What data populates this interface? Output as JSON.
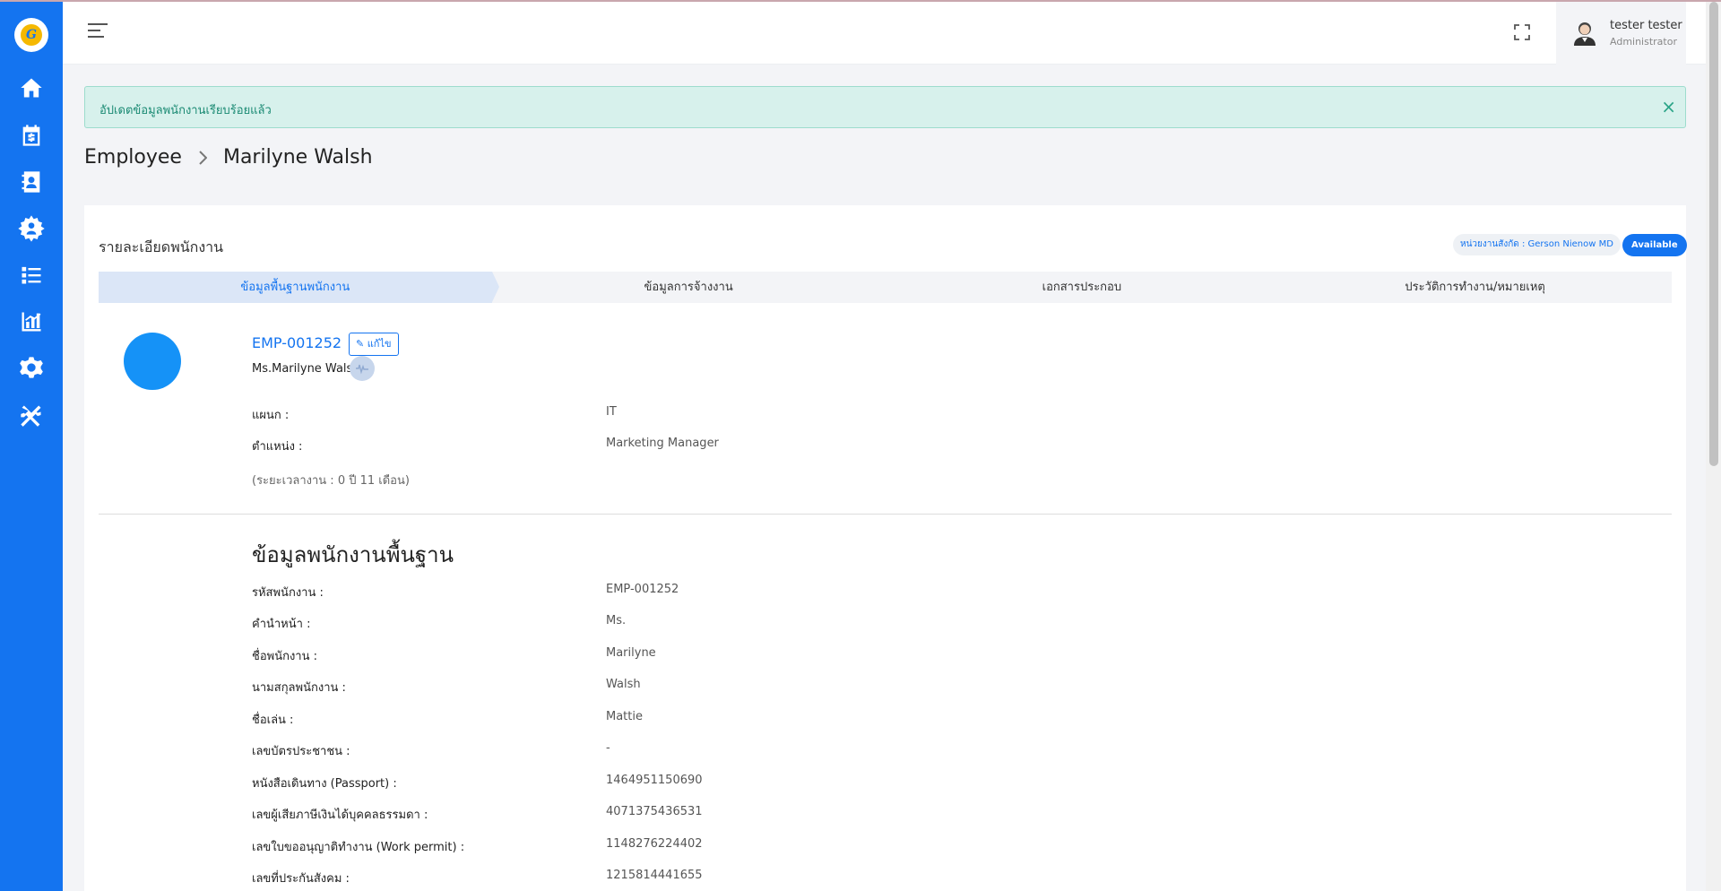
{
  "header": {
    "user_name": "tester tester",
    "user_role": "Administrator"
  },
  "sidebar": {
    "items": [
      {
        "icon": "home-icon"
      },
      {
        "icon": "calendar-dollar-icon"
      },
      {
        "icon": "address-book-icon"
      },
      {
        "icon": "users-cog-icon",
        "active": true
      },
      {
        "icon": "list-icon"
      },
      {
        "icon": "chart-icon"
      },
      {
        "icon": "gear-icon"
      },
      {
        "icon": "tools-icon"
      }
    ]
  },
  "alert": {
    "message": "อัปเดตข้อมูลพนักงานเรียบร้อยแล้ว",
    "close": "×"
  },
  "breadcrumb": {
    "parent": "Employee",
    "current": "Marilyne Walsh"
  },
  "card": {
    "title": "รายละเอียดพนักงาน",
    "department_badge": "หน่วยงานสังกัด : Gerson Nienow MD",
    "status_badge": "Available",
    "tabs": [
      {
        "label": "ข้อมูลพื้นฐานพนักงาน",
        "active": true
      },
      {
        "label": "ข้อมูลการจ้างงาน"
      },
      {
        "label": "เอกสารประกอบ"
      },
      {
        "label": "ประวัติการทำงาน/หมายเหตุ"
      }
    ]
  },
  "profile": {
    "code": "EMP-001252",
    "edit_label": "แก้ไข",
    "full_name": "Ms.Marilyne Walsh",
    "department_label": "แผนก :",
    "department_value": "IT",
    "position_label": "ตำแหน่ง :",
    "position_value": "Marketing Manager",
    "tenure": "(ระยะเวลางาน : 0 ปี 11 เดือน)"
  },
  "basic_info": {
    "title": "ข้อมูลพนักงานพื้นฐาน",
    "rows": [
      {
        "label": "รหัสพนักงาน :",
        "value": "EMP-001252"
      },
      {
        "label": "คำนำหน้า :",
        "value": "Ms."
      },
      {
        "label": "ชื่อพนักงาน :",
        "value": "Marilyne"
      },
      {
        "label": "นามสกุลพนักงาน :",
        "value": "Walsh"
      },
      {
        "label": "ชื่อเล่น :",
        "value": "Mattie"
      },
      {
        "label": "เลขบัตรประชาชน :",
        "value": "-"
      },
      {
        "label": "หนังสือเดินทาง (Passport) :",
        "value": "1464951150690"
      },
      {
        "label": "เลขผู้เสียภาษีเงินได้บุคคลธรรมดา :",
        "value": "4071375436531"
      },
      {
        "label": "เลขใบขออนุญาติทำงาน (Work permit) :",
        "value": "1148276224402"
      },
      {
        "label": "เลขที่ประกันสังคม :",
        "value": "1215814441655"
      }
    ]
  }
}
